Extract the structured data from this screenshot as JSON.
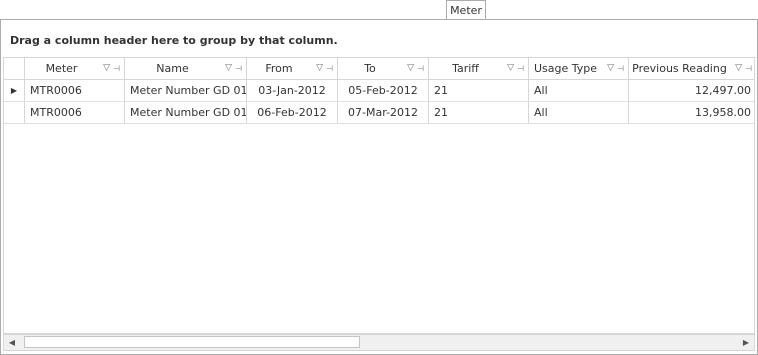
{
  "tab": {
    "label": "Meter"
  },
  "group_panel": {
    "text": "Drag a column header here to group by that column."
  },
  "icons": {
    "row_indicator": "triangle-right",
    "filter": "filter-icon",
    "pin": "pin-icon",
    "scroll_left": "triangle-left",
    "scroll_right": "triangle-right"
  },
  "columns": [
    {
      "label": "Meter"
    },
    {
      "label": "Name"
    },
    {
      "label": "From"
    },
    {
      "label": "To"
    },
    {
      "label": "Tariff"
    },
    {
      "label": "Usage Type"
    },
    {
      "label": "Previous Reading"
    }
  ],
  "rows": [
    {
      "meter": "MTR0006",
      "name": "Meter Number GD 01",
      "from": "03-Jan-2012",
      "to": "05-Feb-2012",
      "tariff": "21",
      "usage_type": "All",
      "previous_reading": "12,497.00"
    },
    {
      "meter": "MTR0006",
      "name": "Meter Number GD 01",
      "from": "06-Feb-2012",
      "to": "07-Mar-2012",
      "tariff": "21",
      "usage_type": "All",
      "previous_reading": "13,958.00"
    }
  ]
}
